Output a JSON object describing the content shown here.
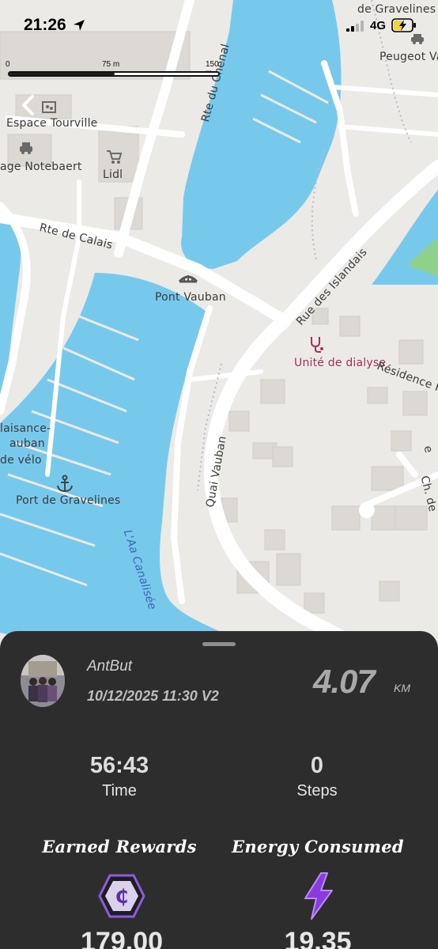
{
  "status_bar": {
    "time": "21:26",
    "network": "4G",
    "location_icon": "location-arrow-icon",
    "battery_icon": "battery-charging-icon"
  },
  "scale_bar": {
    "labels": [
      "0",
      "75 m",
      "150 m"
    ]
  },
  "map": {
    "labels": {
      "espace_tourville": "Espace Tourville",
      "garage": "age Notebaert",
      "lidl": "Lidl",
      "rte_du_chenal": "Rte du Chenal",
      "de_gravelines": "de Gravelines",
      "peugeot": "Peugeot Va",
      "rte_de_calais": "Rte de Calais",
      "pont_vauban": "Pont Vauban",
      "rue_des_islandais": "Rue des Islandais",
      "unite_dialyse": "Unité de dialyse",
      "residence": "Résidence F",
      "plaisance_1": "laisance-",
      "plaisance_2": "auban",
      "plaisance_3": "de vélo",
      "port": "Port de Gravelines",
      "aa": "L'Aa Canalisée",
      "quai_vauban": "Quai Vauban",
      "ch_de": "Ch. de",
      "edge_e": "e"
    },
    "colors": {
      "land": "#eceae6",
      "water": "#77c9ec",
      "park": "#8fd18b",
      "road": "#ffffff"
    }
  },
  "activity": {
    "username": "AntBut",
    "datetime": "10/12/2025 11:30 V2",
    "distance": "4.07",
    "distance_unit": "KM",
    "time_value": "56:43",
    "time_label": "Time",
    "steps_value": "0",
    "steps_label": "Steps",
    "earned_rewards_label": "Earned Rewards",
    "energy_consumed_label": "Energy Consumed",
    "rewards_value": "179.00",
    "energy_value": "19.35"
  },
  "colors": {
    "sheet_bg": "#2d2d2d",
    "accent_purple": "#7a2fd6",
    "token_bg": "#3b2f5a"
  }
}
